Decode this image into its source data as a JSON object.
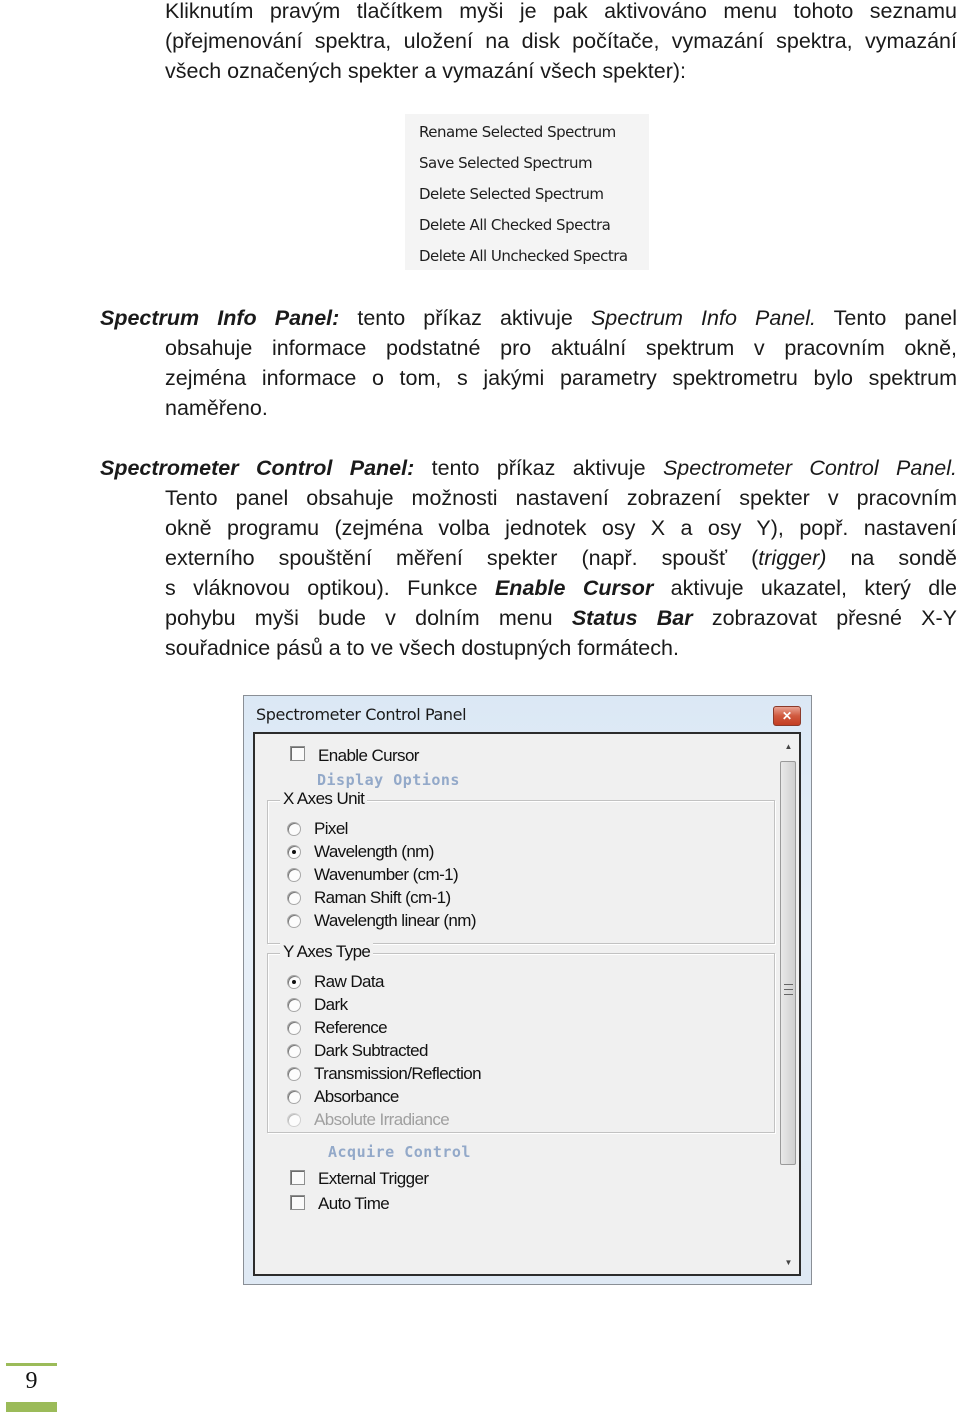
{
  "intro": {
    "lines": [
      "Kliknutím pravým tlačítkem myši je pak aktivováno menu tohoto seznamu",
      "(přejmenování spektra, uložení na disk počítače, vymazání spektra, vymazání",
      "všech označených spekter a vymazání všech spekter):"
    ]
  },
  "context_menu": {
    "items": [
      "Rename Selected Spectrum",
      "Save Selected Spectrum",
      "Delete Selected Spectrum",
      "Delete All Checked Spectra",
      "Delete All Unchecked Spectra"
    ]
  },
  "spectrum_info": {
    "term": "Spectrum Info Panel:",
    "line1_a": " tento příkaz aktivuje ",
    "line1_italic": "Spectrum Info Panel.",
    "line1_b": " Tento panel",
    "line2": "obsahuje informace podstatné pro aktuální spektrum v pracovním okně,",
    "line3": "zejména informace o tom, s jakými parametry spektrometru bylo spektrum",
    "line4": "naměřeno."
  },
  "spectrometer_control": {
    "term": "Spectrometer Control Panel:",
    "line1_a": " tento příkaz aktivuje ",
    "line1_italic": "Spectrometer Control Panel.",
    "line2": "Tento panel obsahuje možnosti nastavení zobrazení spekter v pracovním",
    "line3": "okně programu (zejména volba jednotek osy X a osy Y), popř. nastavení",
    "line4_a": "externího spouštění měření spekter (např. spoušť (",
    "line4_italic": "trigger)",
    "line4_b": " na sondě",
    "line5_a": "s vláknovou optikou). Funkce ",
    "line5_bold": "Enable Cursor",
    "line5_b": " aktivuje ukazatel, který dle",
    "line6_a": "pohybu myši bude v dolním menu ",
    "line6_bold": "Status Bar",
    "line6_b": " zobrazovat přesné X-Y",
    "line7": "souřadnice pásů a to ve všech dostupných formátech."
  },
  "dialog": {
    "title": "Spectrometer Control Panel",
    "close_glyph": "✕",
    "enable_cursor": {
      "label": "Enable Cursor",
      "checked": false
    },
    "display_options_label": "Display Options",
    "x_axes": {
      "legend": "X Axes Unit",
      "options": [
        {
          "label": "Pixel",
          "selected": false
        },
        {
          "label": "Wavelength (nm)",
          "selected": true
        },
        {
          "label": "Wavenumber (cm-1)",
          "selected": false
        },
        {
          "label": "Raman Shift (cm-1)",
          "selected": false
        },
        {
          "label": "Wavelength linear (nm)",
          "selected": false
        }
      ]
    },
    "y_axes": {
      "legend": "Y Axes Type",
      "options": [
        {
          "label": "Raw Data",
          "selected": true
        },
        {
          "label": "Dark",
          "selected": false
        },
        {
          "label": "Reference",
          "selected": false
        },
        {
          "label": "Dark Subtracted",
          "selected": false
        },
        {
          "label": "Transmission/Reflection",
          "selected": false
        },
        {
          "label": "Absorbance",
          "selected": false
        },
        {
          "label": "Absolute Irradiance",
          "selected": false,
          "disabled": true
        }
      ]
    },
    "acquire_control_label": "Acquire Control",
    "external_trigger": {
      "label": "External Trigger",
      "checked": false
    },
    "auto_time": {
      "label": "Auto Time",
      "checked": false
    },
    "scroll_up_glyph": "▲",
    "scroll_down_glyph": "▼"
  },
  "footer": {
    "page_number": "9",
    "accent_color": "#9bbb59"
  }
}
